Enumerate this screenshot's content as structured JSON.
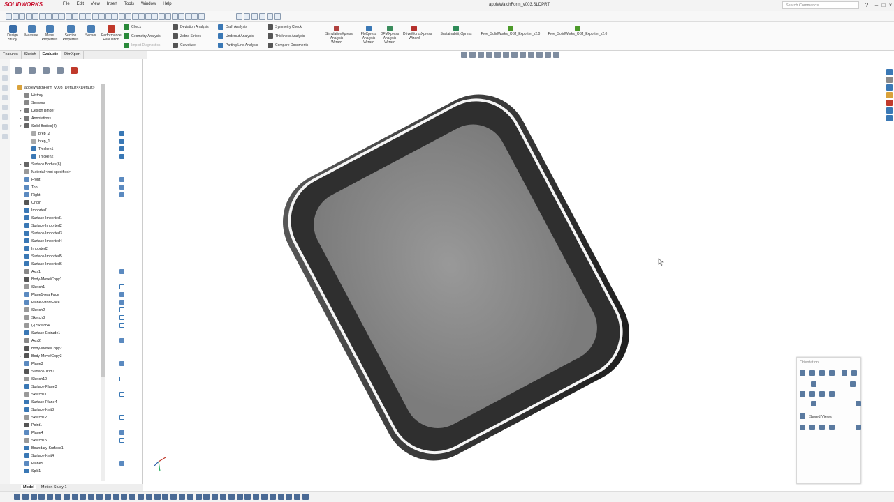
{
  "app": {
    "brand": "SOLIDWORKS",
    "title": "appleWatchForm_v003.SLDPRT"
  },
  "menu": [
    "File",
    "Edit",
    "View",
    "Insert",
    "Tools",
    "Window",
    "Help"
  ],
  "search": {
    "placeholder": "Search Commands"
  },
  "window_buttons": [
    "?",
    "–",
    "□",
    "×"
  ],
  "command_manager": {
    "big": [
      {
        "label": "Design Study",
        "color": "#3a6ea8"
      },
      {
        "label": "Measure",
        "color": "#4a7fb5"
      },
      {
        "label": "Mass Properties",
        "color": "#4a7fb5"
      },
      {
        "label": "Section Properties",
        "color": "#4a7fb5"
      },
      {
        "label": "Sensor",
        "color": "#4a7fb5"
      },
      {
        "label": "Performance Evaluation",
        "color": "#c0392b"
      }
    ],
    "small_col1": [
      "Check",
      "Geometry Analysis",
      "Import Diagnostics"
    ],
    "small_col2": [
      "Deviation Analysis",
      "Zebra Stripes",
      "Curvature"
    ],
    "small_col3": [
      "Draft Analysis",
      "Undercut Analysis",
      "Parting Line Analysis"
    ],
    "small_col4": [
      "Symmetry Check",
      "Thickness Analysis",
      "Compare Documents"
    ],
    "xpress": [
      {
        "label": "SimulationXpress Analysis Wizard",
        "color": "#b0413e"
      },
      {
        "label": "FloXpress Analysis Wizard",
        "color": "#3a78b5"
      },
      {
        "label": "DFMXpress Analysis Wizard",
        "color": "#3a8c5c"
      },
      {
        "label": "DriveWorksXpress Wizard",
        "color": "#b5302c"
      },
      {
        "label": "SustainabilityXpress",
        "color": "#2e8b57"
      },
      {
        "label": "Free_SolidWorks_OBJ_Exporter_v2.0",
        "color": "#4c9a2a"
      },
      {
        "label": "Free_SolidWorks_OBJ_Exporter_v2.0",
        "color": "#4c9a2a"
      }
    ]
  },
  "tabs": [
    "Features",
    "Sketch",
    "Evaluate",
    "DimXpert"
  ],
  "active_tab": "Evaluate",
  "tree": [
    {
      "label": "appleWatchForm_v003 (Default<<Default>",
      "indent": 0,
      "icon": "part",
      "color": "#d9a23b",
      "expand": ""
    },
    {
      "label": "History",
      "indent": 1,
      "icon": "history",
      "color": "#888",
      "expand": ""
    },
    {
      "label": "Sensors",
      "indent": 1,
      "icon": "sensor",
      "color": "#888",
      "expand": ""
    },
    {
      "label": "Design Binder",
      "indent": 1,
      "icon": "binder",
      "color": "#777",
      "expand": "▸"
    },
    {
      "label": "Annotations",
      "indent": 1,
      "icon": "annot",
      "color": "#777",
      "expand": "▸"
    },
    {
      "label": "Solid Bodies(4)",
      "indent": 1,
      "icon": "solid",
      "color": "#666",
      "expand": "▾"
    },
    {
      "label": "brep_2",
      "indent": 2,
      "icon": "body",
      "color": "#aaa",
      "expand": ""
    },
    {
      "label": "brep_1",
      "indent": 2,
      "icon": "body",
      "color": "#aaa",
      "expand": ""
    },
    {
      "label": "Thicken1",
      "indent": 2,
      "icon": "body",
      "color": "#3a78b5",
      "expand": ""
    },
    {
      "label": "Thicken2",
      "indent": 2,
      "icon": "body",
      "color": "#3a78b5",
      "expand": ""
    },
    {
      "label": "Surface Bodies(6)",
      "indent": 1,
      "icon": "surf",
      "color": "#666",
      "expand": "▸"
    },
    {
      "label": "Material <not specified>",
      "indent": 1,
      "icon": "mat",
      "color": "#999",
      "expand": ""
    },
    {
      "label": "Front",
      "indent": 1,
      "icon": "plane",
      "color": "#5b8ac0",
      "expand": ""
    },
    {
      "label": "Top",
      "indent": 1,
      "icon": "plane",
      "color": "#5b8ac0",
      "expand": ""
    },
    {
      "label": "Right",
      "indent": 1,
      "icon": "plane",
      "color": "#5b8ac0",
      "expand": ""
    },
    {
      "label": "Origin",
      "indent": 1,
      "icon": "origin",
      "color": "#555",
      "expand": ""
    },
    {
      "label": "Imported1",
      "indent": 1,
      "icon": "imp",
      "color": "#3a78b5",
      "expand": ""
    },
    {
      "label": "Surface-Imported1",
      "indent": 1,
      "icon": "simp",
      "color": "#3a78b5",
      "expand": ""
    },
    {
      "label": "Surface-Imported2",
      "indent": 1,
      "icon": "simp",
      "color": "#3a78b5",
      "expand": ""
    },
    {
      "label": "Surface-Imported3",
      "indent": 1,
      "icon": "simp",
      "color": "#3a78b5",
      "expand": ""
    },
    {
      "label": "Surface-Imported4",
      "indent": 1,
      "icon": "simp",
      "color": "#3a78b5",
      "expand": ""
    },
    {
      "label": "Imported2",
      "indent": 1,
      "icon": "imp",
      "color": "#3a78b5",
      "expand": ""
    },
    {
      "label": "Surface-Imported5",
      "indent": 1,
      "icon": "simp",
      "color": "#3a78b5",
      "expand": ""
    },
    {
      "label": "Surface-Imported6",
      "indent": 1,
      "icon": "simp",
      "color": "#3a78b5",
      "expand": ""
    },
    {
      "label": "Axis1",
      "indent": 1,
      "icon": "axis",
      "color": "#888",
      "expand": ""
    },
    {
      "label": "Body-Move/Copy1",
      "indent": 1,
      "icon": "move",
      "color": "#555",
      "expand": ""
    },
    {
      "label": "Sketch1",
      "indent": 1,
      "icon": "sketch",
      "color": "#999",
      "expand": ""
    },
    {
      "label": "Plane1-rearFace",
      "indent": 1,
      "icon": "plane",
      "color": "#5b8ac0",
      "expand": ""
    },
    {
      "label": "Plane2-frontFace",
      "indent": 1,
      "icon": "plane",
      "color": "#5b8ac0",
      "expand": ""
    },
    {
      "label": "Sketch2",
      "indent": 1,
      "icon": "sketch",
      "color": "#999",
      "expand": ""
    },
    {
      "label": "Sketch3",
      "indent": 1,
      "icon": "sketch",
      "color": "#999",
      "expand": ""
    },
    {
      "label": "(-) Sketch4",
      "indent": 1,
      "icon": "sketch",
      "color": "#999",
      "expand": ""
    },
    {
      "label": "Surface-Extrude1",
      "indent": 1,
      "icon": "simp",
      "color": "#3a78b5",
      "expand": ""
    },
    {
      "label": "Axis2",
      "indent": 1,
      "icon": "axis",
      "color": "#888",
      "expand": ""
    },
    {
      "label": "Body-Move/Copy2",
      "indent": 1,
      "icon": "move",
      "color": "#555",
      "expand": ""
    },
    {
      "label": "Body-Move/Copy3",
      "indent": 1,
      "icon": "move",
      "color": "#555",
      "expand": "▸"
    },
    {
      "label": "Plane3",
      "indent": 1,
      "icon": "plane",
      "color": "#5b8ac0",
      "expand": ""
    },
    {
      "label": "Surface-Trim1",
      "indent": 1,
      "icon": "trim",
      "color": "#555",
      "expand": ""
    },
    {
      "label": "Sketch10",
      "indent": 1,
      "icon": "sketch",
      "color": "#999",
      "expand": ""
    },
    {
      "label": "Surface-Plane3",
      "indent": 1,
      "icon": "simp",
      "color": "#3a78b5",
      "expand": ""
    },
    {
      "label": "Sketch11",
      "indent": 1,
      "icon": "sketch",
      "color": "#999",
      "expand": ""
    },
    {
      "label": "Surface-Plane4",
      "indent": 1,
      "icon": "simp",
      "color": "#3a78b5",
      "expand": ""
    },
    {
      "label": "Surface-Knit3",
      "indent": 1,
      "icon": "simp",
      "color": "#3a78b5",
      "expand": ""
    },
    {
      "label": "Sketch12",
      "indent": 1,
      "icon": "sketch",
      "color": "#999",
      "expand": ""
    },
    {
      "label": "Point1",
      "indent": 1,
      "icon": "point",
      "color": "#555",
      "expand": ""
    },
    {
      "label": "Plane4",
      "indent": 1,
      "icon": "plane",
      "color": "#5b8ac0",
      "expand": ""
    },
    {
      "label": "Sketch15",
      "indent": 1,
      "icon": "sketch",
      "color": "#999",
      "expand": ""
    },
    {
      "label": "Boundary-Surface1",
      "indent": 1,
      "icon": "simp",
      "color": "#3a78b5",
      "expand": ""
    },
    {
      "label": "Surface-Knit4",
      "indent": 1,
      "icon": "simp",
      "color": "#3a78b5",
      "expand": ""
    },
    {
      "label": "Plane5",
      "indent": 1,
      "icon": "plane",
      "color": "#5b8ac0",
      "expand": ""
    },
    {
      "label": "Split1",
      "indent": 1,
      "icon": "split",
      "color": "#3a78b5",
      "expand": ""
    }
  ],
  "orientation": {
    "title": "Orientation",
    "saved_views": "Saved Views"
  },
  "bottom_tabs": [
    "Model",
    "Motion Study 1"
  ],
  "colors": {
    "accent": "#c8102e",
    "body_dark": "#3a3a3a",
    "screen": "#8e8e8e"
  }
}
